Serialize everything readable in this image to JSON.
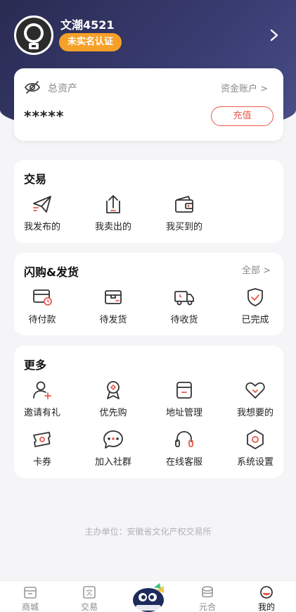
{
  "profile": {
    "username": "文潮4521",
    "badge": "未实名认证"
  },
  "assets": {
    "label": "总资产",
    "account_link": "资金账户 >",
    "amount": "*****",
    "recharge": "充值"
  },
  "trade": {
    "title": "交易",
    "items": [
      {
        "label": "我发布的",
        "icon": "paper-plane-icon"
      },
      {
        "label": "我卖出的",
        "icon": "box-upload-icon"
      },
      {
        "label": "我买到的",
        "icon": "wallet-icon"
      }
    ]
  },
  "flash": {
    "title": "闪购&发货",
    "more": "全部 >",
    "items": [
      {
        "label": "待付款",
        "icon": "card-clock-icon"
      },
      {
        "label": "待发货",
        "icon": "package-icon"
      },
      {
        "label": "待收货",
        "icon": "truck-icon"
      },
      {
        "label": "已完成",
        "icon": "shield-check-icon"
      }
    ]
  },
  "more": {
    "title": "更多",
    "items": [
      {
        "label": "邀请有礼",
        "icon": "user-plus-icon"
      },
      {
        "label": "优先购",
        "icon": "ribbon-icon"
      },
      {
        "label": "地址管理",
        "icon": "address-box-icon"
      },
      {
        "label": "我想要的",
        "icon": "heart-icon"
      },
      {
        "label": "卡券",
        "icon": "ticket-icon"
      },
      {
        "label": "加入社群",
        "icon": "chat-icon"
      },
      {
        "label": "在线客服",
        "icon": "headset-icon"
      },
      {
        "label": "系统设置",
        "icon": "settings-hex-icon"
      }
    ]
  },
  "footer_note": "主办单位：安徽省文化产权交易所",
  "tabbar": [
    {
      "label": "商城",
      "icon": "shop-icon",
      "active": false
    },
    {
      "label": "交易",
      "icon": "trade-icon",
      "active": false
    },
    {
      "label": "",
      "icon": "mascot-icon",
      "active": false
    },
    {
      "label": "元合",
      "icon": "coins-icon",
      "active": false
    },
    {
      "label": "我的",
      "icon": "profile-face-icon",
      "active": true
    }
  ],
  "colors": {
    "accent": "#e85a4f",
    "hero": "#2e3060",
    "badge": "#f5a028"
  }
}
